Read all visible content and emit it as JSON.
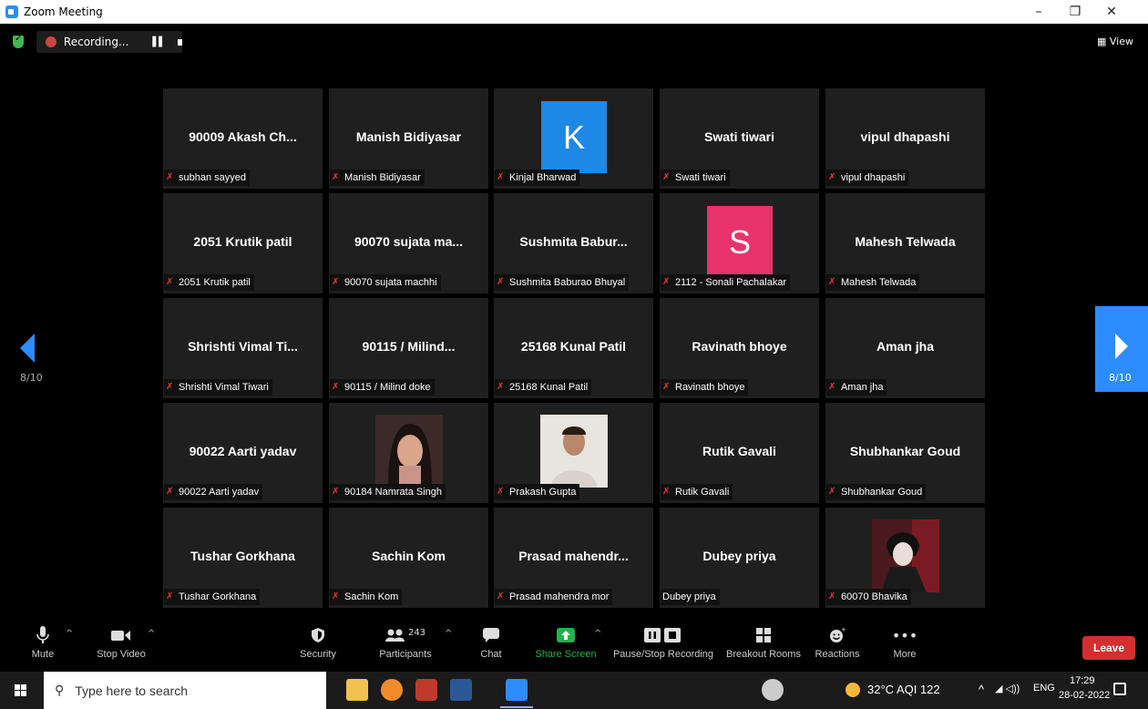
{
  "window": {
    "title": "Zoom Meeting",
    "controls": [
      "–",
      "❐",
      "✕"
    ]
  },
  "topbar": {
    "recording_label": "Recording...",
    "view_label": "View"
  },
  "gallery": {
    "page_indicator_left": "8/10",
    "page_indicator_right": "8/10",
    "tiles": [
      {
        "display": "90009 Akash Ch...",
        "name": "subhan sayyed",
        "muted": true
      },
      {
        "display": "Manish Bidiyasar",
        "name": "Manish Bidiyasar",
        "muted": true
      },
      {
        "display": "K",
        "avatar_color": "#1e88e5",
        "name": "Kinjal Bharwad",
        "muted": true
      },
      {
        "display": "Swati tiwari",
        "name": "Swati tiwari",
        "muted": true
      },
      {
        "display": "vipul dhapashi",
        "name": "vipul dhapashi",
        "muted": true
      },
      {
        "display": "2051 Krutik patil",
        "name": "2051 Krutik patil",
        "muted": true
      },
      {
        "display": "90070 sujata ma...",
        "name": "90070 sujata machhi",
        "muted": true
      },
      {
        "display": "Sushmita  Babur...",
        "name": "Sushmita Baburao Bhuyal",
        "muted": true
      },
      {
        "display": "S",
        "avatar_color": "#e8336d",
        "name": "2112 - Sonali Pachalakar",
        "muted": true
      },
      {
        "display": "Mahesh Telwada",
        "name": "Mahesh Telwada",
        "muted": true
      },
      {
        "display": "Shrishti  Vimal Ti...",
        "name": "Shrishti Vimal Tiwari",
        "muted": true
      },
      {
        "display": "90115 / Milind...",
        "name": "90115 / Milind doke",
        "muted": true
      },
      {
        "display": "25168 Kunal Patil",
        "name": "25168 Kunal Patil",
        "muted": true
      },
      {
        "display": "Ravinath bhoye",
        "name": "Ravinath bhoye",
        "muted": true
      },
      {
        "display": "Aman jha",
        "name": "Aman jha",
        "muted": true
      },
      {
        "display": "90022 Aarti yadav",
        "name": "90022 Aarti yadav",
        "muted": true
      },
      {
        "display": "",
        "photo": "woman-photo",
        "name": "90184 Namrata Singh",
        "muted": true
      },
      {
        "display": "",
        "photo": "man-photo",
        "name": "Prakash Gupta",
        "muted": true
      },
      {
        "display": "Rutik Gavali",
        "name": "Rutik Gavali",
        "muted": true
      },
      {
        "display": "Shubhankar Goud",
        "name": "Shubhankar Goud",
        "muted": true
      },
      {
        "display": "Tushar Gorkhana",
        "name": "Tushar Gorkhana",
        "muted": true
      },
      {
        "display": "Sachin Kom",
        "name": "Sachin Kom",
        "muted": true
      },
      {
        "display": "Prasad  mahendr...",
        "name": "Prasad mahendra mor",
        "muted": true
      },
      {
        "display": "Dubey priya",
        "name": "Dubey priya",
        "muted": false
      },
      {
        "display": "",
        "photo": "anime-photo",
        "name": "60070 Bhavika",
        "muted": true
      }
    ]
  },
  "toolbar": {
    "mute": "Mute",
    "stop_video": "Stop Video",
    "security": "Security",
    "participants": "Participants",
    "participant_count": "243",
    "chat": "Chat",
    "share_screen": "Share Screen",
    "pause_stop_recording": "Pause/Stop Recording",
    "breakout_rooms": "Breakout Rooms",
    "reactions": "Reactions",
    "more": "More",
    "leave": "Leave"
  },
  "taskbar": {
    "search_placeholder": "Type here to search",
    "weather": "32°C  AQI 122",
    "language": "ENG",
    "time": "17:29",
    "date": "28-02-2022"
  },
  "colors": {
    "accent": "#2d8cff",
    "leave": "#d32f2f",
    "share": "#22b24c"
  }
}
